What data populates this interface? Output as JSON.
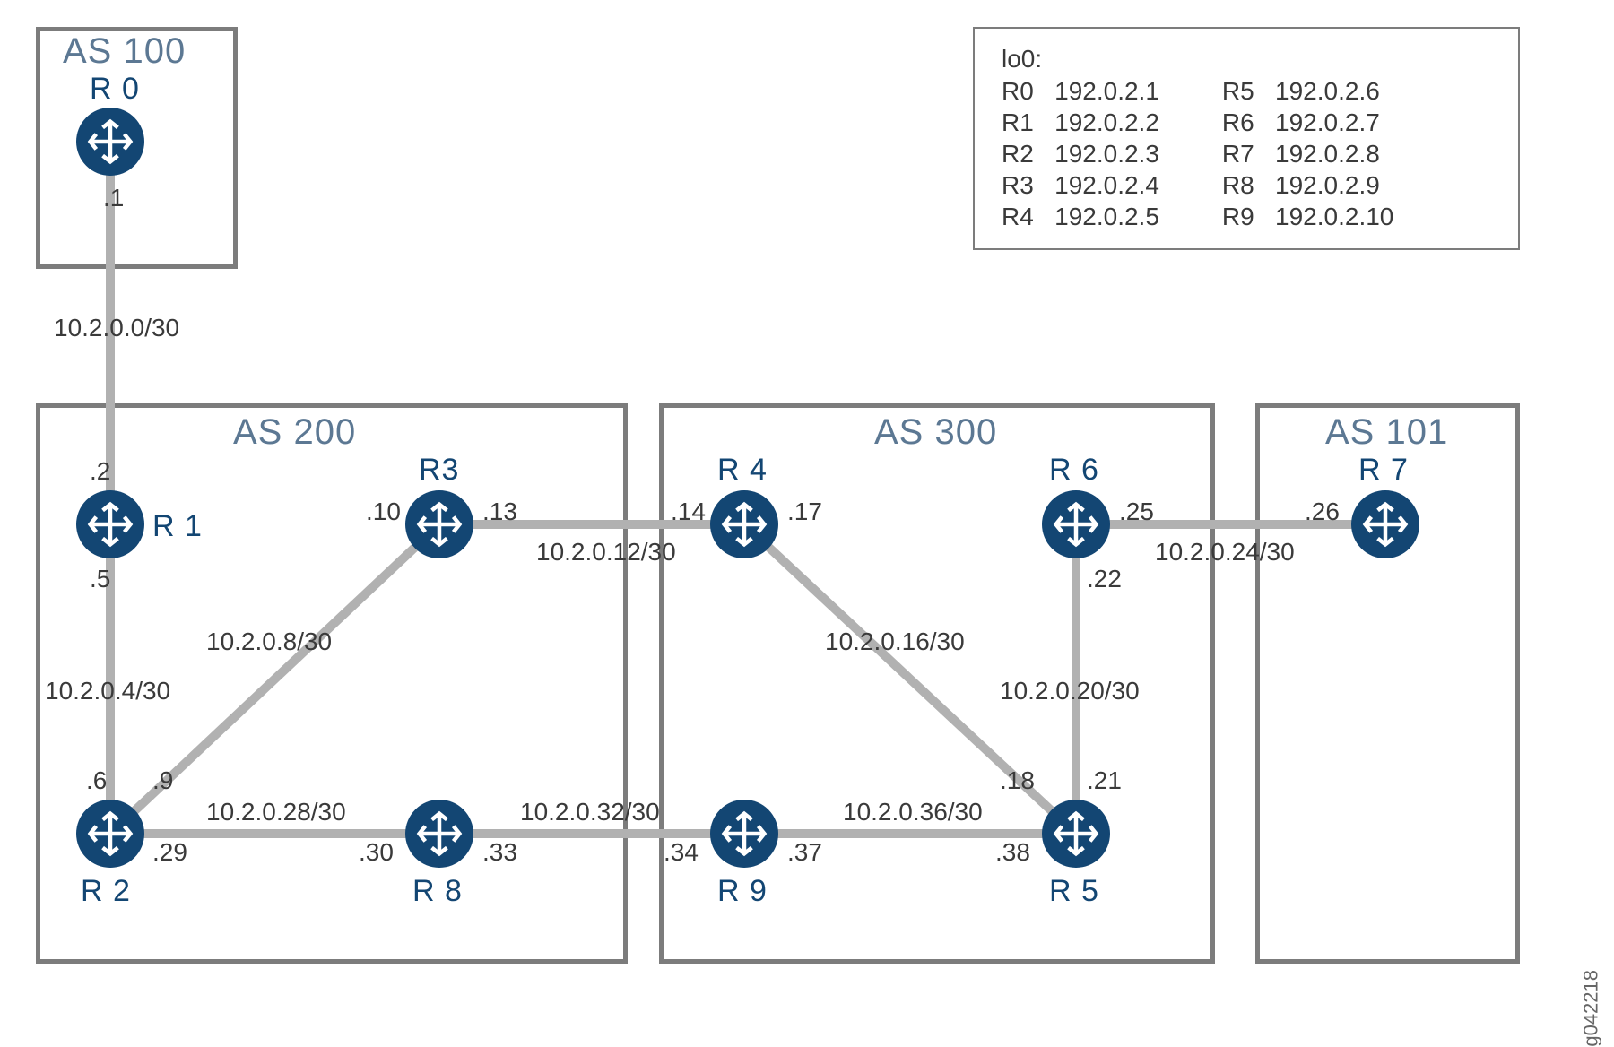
{
  "figure_id": "g042218",
  "legend": {
    "title": "lo0:",
    "left": [
      {
        "r": "R0",
        "ip": "192.0.2.1"
      },
      {
        "r": "R1",
        "ip": "192.0.2.2"
      },
      {
        "r": "R2",
        "ip": "192.0.2.3"
      },
      {
        "r": "R3",
        "ip": "192.0.2.4"
      },
      {
        "r": "R4",
        "ip": "192.0.2.5"
      }
    ],
    "right": [
      {
        "r": "R5",
        "ip": "192.0.2.6"
      },
      {
        "r": "R6",
        "ip": "192.0.2.7"
      },
      {
        "r": "R7",
        "ip": "192.0.2.8"
      },
      {
        "r": "R8",
        "ip": "192.0.2.9"
      },
      {
        "r": "R9",
        "ip": "192.0.2.10"
      }
    ]
  },
  "as": {
    "as100": "AS 100",
    "as200": "AS 200",
    "as300": "AS 300",
    "as101": "AS 101"
  },
  "routers": {
    "r0": "R 0",
    "r1": "R 1",
    "r2": "R 2",
    "r3": "R3",
    "r4": "R 4",
    "r5": "R 5",
    "r6": "R 6",
    "r7": "R 7",
    "r8": "R 8",
    "r9": "R 9"
  },
  "subnets": {
    "s0": "10.2.0.0/30",
    "s4": "10.2.0.4/30",
    "s8": "10.2.0.8/30",
    "s12": "10.2.0.12/30",
    "s16": "10.2.0.16/30",
    "s20": "10.2.0.20/30",
    "s24": "10.2.0.24/30",
    "s28": "10.2.0.28/30",
    "s32": "10.2.0.32/30",
    "s36": "10.2.0.36/30"
  },
  "hosts": {
    "h1": ".1",
    "h2": ".2",
    "h5": ".5",
    "h6": ".6",
    "h9": ".9",
    "h10": ".10",
    "h13": ".13",
    "h14": ".14",
    "h17": ".17",
    "h18": ".18",
    "h21": ".21",
    "h22": ".22",
    "h25": ".25",
    "h26": ".26",
    "h29": ".29",
    "h30": ".30",
    "h33": ".33",
    "h34": ".34",
    "h37": ".37",
    "h38": ".38"
  }
}
